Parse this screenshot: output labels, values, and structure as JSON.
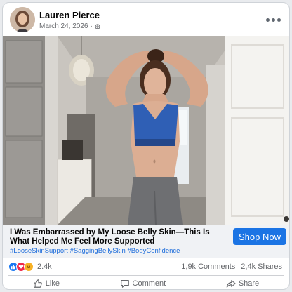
{
  "post": {
    "author": "Lauren Pierce",
    "date": "March 24, 2026",
    "audience_icon": "globe-icon",
    "more_icon": "more-options-icon"
  },
  "ad": {
    "headline": "I Was Embarrassed by My Loose Belly Skin—This Is What Helped Me Feel More Supported",
    "hashtags": [
      "#LooseSkinSupport",
      "#SaggingBellySkin",
      "#BodyConfidence"
    ],
    "cta_label": "Shop Now"
  },
  "stats": {
    "reactions_count": "2.4k",
    "comments": "1,9k Comments",
    "shares": "2,4k Shares"
  },
  "actions": {
    "like": "Like",
    "comment": "Comment",
    "share": "Share"
  },
  "colors": {
    "cta": "#1b74e4",
    "hashtag": "#216fdb",
    "sports_bra": "#2f5fb5"
  }
}
